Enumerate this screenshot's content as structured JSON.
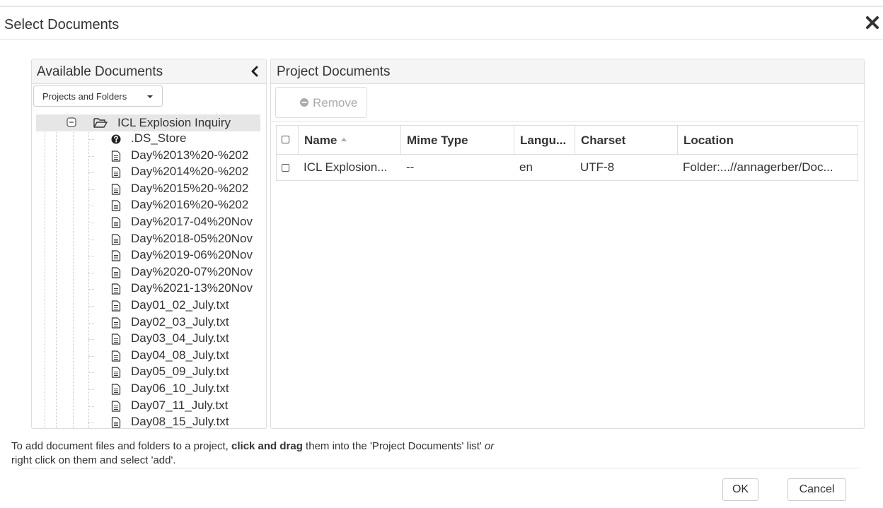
{
  "dialog": {
    "title": "Select Documents",
    "close_icon": "close-x-icon"
  },
  "available": {
    "title": "Available Documents",
    "collapse_icon": "chevron-left-icon",
    "dropdown_label": "Projects and Folders",
    "tree": {
      "root": {
        "label": "ICL Explosion Inquiry",
        "icons": [
          "minus-square-icon",
          "folder-open-icon"
        ]
      },
      "items": [
        {
          "label": ".DS_Store",
          "icon": "question-circle-icon"
        },
        {
          "label": "Day%2013%20-%202",
          "icon": "file-text-icon"
        },
        {
          "label": "Day%2014%20-%202",
          "icon": "file-text-icon"
        },
        {
          "label": "Day%2015%20-%202",
          "icon": "file-text-icon"
        },
        {
          "label": "Day%2016%20-%202",
          "icon": "file-text-icon"
        },
        {
          "label": "Day%2017-04%20Nov",
          "icon": "file-text-icon"
        },
        {
          "label": "Day%2018-05%20Nov",
          "icon": "file-text-icon"
        },
        {
          "label": "Day%2019-06%20Nov",
          "icon": "file-text-icon"
        },
        {
          "label": "Day%2020-07%20Nov",
          "icon": "file-text-icon"
        },
        {
          "label": "Day%2021-13%20Nov",
          "icon": "file-text-icon"
        },
        {
          "label": "Day01_02_July.txt",
          "icon": "file-text-icon"
        },
        {
          "label": "Day02_03_July.txt",
          "icon": "file-text-icon"
        },
        {
          "label": "Day03_04_July.txt",
          "icon": "file-text-icon"
        },
        {
          "label": "Day04_08_July.txt",
          "icon": "file-text-icon"
        },
        {
          "label": "Day05_09_July.txt",
          "icon": "file-text-icon"
        },
        {
          "label": "Day06_10_July.txt",
          "icon": "file-text-icon"
        },
        {
          "label": "Day07_11_July.txt",
          "icon": "file-text-icon"
        },
        {
          "label": "Day08_15_July.txt",
          "icon": "file-text-icon"
        }
      ]
    }
  },
  "project": {
    "title": "Project Documents",
    "remove_label": "Remove",
    "remove_icon": "minus-circle-icon",
    "columns": [
      "Name",
      "Mime Type",
      "Langu...",
      "Charset",
      "Location"
    ],
    "sort_icon": "sort-asc-icon",
    "rows": [
      {
        "name": "ICL Explosion...",
        "mime": "--",
        "language": "en",
        "charset": "UTF-8",
        "location": "Folder:...//annagerber/Doc..."
      }
    ]
  },
  "help": {
    "part1": "To add document files and folders to a project, ",
    "bold": "click and drag",
    "part2": " them into the 'Project Documents' list' ",
    "italic": "or",
    "part3": "right click on them and select 'add'."
  },
  "buttons": {
    "ok": "OK",
    "cancel": "Cancel"
  },
  "colors": {
    "panel_header_bg": "#f5f5f5",
    "selected_row_bg": "#e6e6e6",
    "border": "#dddddd"
  }
}
